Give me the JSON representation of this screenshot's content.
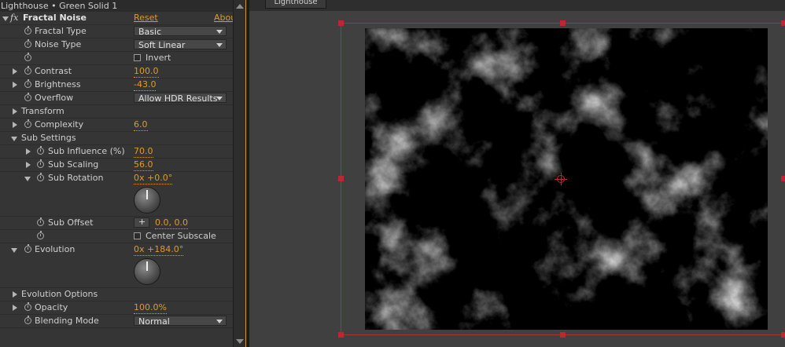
{
  "window": {
    "title": "Lighthouse • Green Solid 1"
  },
  "effect": {
    "name": "Fractal Noise",
    "reset": "Reset",
    "about": "Abou"
  },
  "props": {
    "fractal_type": {
      "label": "Fractal Type",
      "value": "Basic"
    },
    "noise_type": {
      "label": "Noise Type",
      "value": "Soft Linear"
    },
    "invert": {
      "label": "Invert",
      "checked": false
    },
    "contrast": {
      "label": "Contrast",
      "value": "100.0"
    },
    "brightness": {
      "label": "Brightness",
      "value": "-43.0"
    },
    "overflow": {
      "label": "Overflow",
      "value": "Allow HDR Results"
    },
    "transform": {
      "label": "Transform"
    },
    "complexity": {
      "label": "Complexity",
      "value": "6.0"
    },
    "sub_settings": {
      "label": "Sub Settings"
    },
    "sub_influence": {
      "label": "Sub Influence (%)",
      "value": "70.0"
    },
    "sub_scaling": {
      "label": "Sub Scaling",
      "value": "56.0"
    },
    "sub_rotation": {
      "label": "Sub Rotation",
      "value": "0x +0.0°"
    },
    "sub_offset": {
      "label": "Sub Offset",
      "value": "0.0, 0.0"
    },
    "center_subscale": {
      "label": "Center Subscale",
      "checked": false
    },
    "evolution": {
      "label": "Evolution",
      "value": "0x +184.0°"
    },
    "evolution_options": {
      "label": "Evolution Options"
    },
    "opacity": {
      "label": "Opacity",
      "value": "100.0%"
    },
    "blending_mode": {
      "label": "Blending Mode",
      "value": "Normal"
    }
  },
  "composition": {
    "tab": "Lighthouse"
  },
  "colors": {
    "accent": "#d99c2f",
    "selection": "#c0262f",
    "panel": "#353535"
  }
}
